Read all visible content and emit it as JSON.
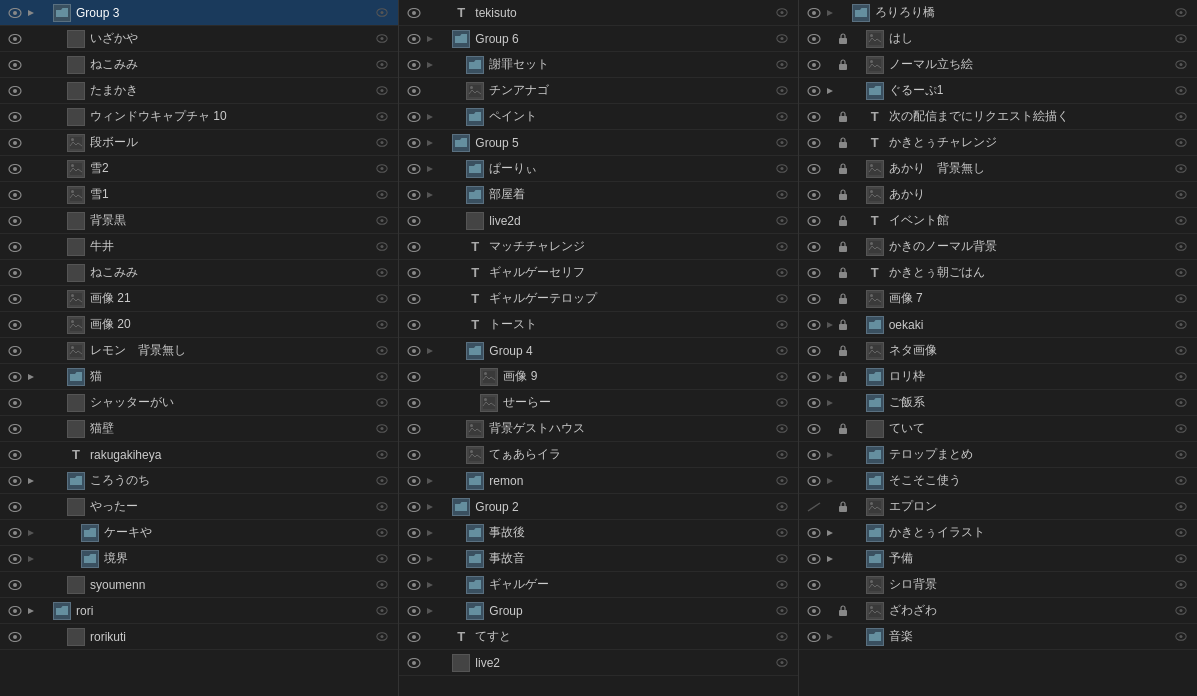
{
  "colors": {
    "bg": "#1e1e1e",
    "selected": "#1a3a5c",
    "text": "#cccccc",
    "muted": "#888888"
  },
  "columns": [
    {
      "id": "col1",
      "items": [
        {
          "name": "Group 3",
          "type": "folder",
          "indent": 0,
          "eye": true,
          "lock": false,
          "expand": true,
          "selected": true
        },
        {
          "name": "いざかや",
          "type": "layer",
          "indent": 1,
          "eye": true,
          "lock": false,
          "expand": false
        },
        {
          "name": "ねこみみ",
          "type": "layer",
          "indent": 1,
          "eye": true,
          "lock": false,
          "expand": false
        },
        {
          "name": "たまかき",
          "type": "layer",
          "indent": 1,
          "eye": true,
          "lock": false,
          "expand": false
        },
        {
          "name": "ウィンドウキャプチャ 10",
          "type": "layer",
          "indent": 1,
          "eye": true,
          "lock": false,
          "expand": false
        },
        {
          "name": "段ボール",
          "type": "image",
          "indent": 1,
          "eye": true,
          "lock": false,
          "expand": false
        },
        {
          "name": "雪2",
          "type": "image",
          "indent": 1,
          "eye": true,
          "lock": false,
          "expand": false
        },
        {
          "name": "雪1",
          "type": "image",
          "indent": 1,
          "eye": true,
          "lock": false,
          "expand": false
        },
        {
          "name": "背景黒",
          "type": "layer",
          "indent": 1,
          "eye": true,
          "lock": false,
          "expand": false
        },
        {
          "name": "牛井",
          "type": "layer",
          "indent": 1,
          "eye": true,
          "lock": false,
          "expand": false
        },
        {
          "name": "ねこみみ",
          "type": "layer",
          "indent": 1,
          "eye": true,
          "lock": false,
          "expand": false
        },
        {
          "name": "画像 21",
          "type": "image",
          "indent": 1,
          "eye": true,
          "lock": false,
          "expand": false
        },
        {
          "name": "画像 20",
          "type": "image",
          "indent": 1,
          "eye": true,
          "lock": false,
          "expand": false
        },
        {
          "name": "レモン　背景無し",
          "type": "image",
          "indent": 1,
          "eye": true,
          "lock": false,
          "expand": false
        },
        {
          "name": "猫",
          "type": "folder",
          "indent": 1,
          "eye": true,
          "lock": false,
          "expand": true
        },
        {
          "name": "シャッターがい",
          "type": "layer",
          "indent": 1,
          "eye": true,
          "lock": false,
          "expand": false
        },
        {
          "name": "猫壁",
          "type": "layer",
          "indent": 1,
          "eye": true,
          "lock": false,
          "expand": false
        },
        {
          "name": "rakugakiheya",
          "type": "text",
          "indent": 1,
          "eye": true,
          "lock": false,
          "expand": false
        },
        {
          "name": "ころうのち",
          "type": "folder",
          "indent": 1,
          "eye": true,
          "lock": false,
          "expand": true
        },
        {
          "name": "やったー",
          "type": "layer",
          "indent": 1,
          "eye": true,
          "lock": false,
          "expand": false
        },
        {
          "name": "ケーキや",
          "type": "folder",
          "indent": 2,
          "eye": true,
          "lock": false,
          "expand": false
        },
        {
          "name": "境界",
          "type": "folder",
          "indent": 2,
          "eye": true,
          "lock": false,
          "expand": false
        },
        {
          "name": "syoumenn",
          "type": "layer",
          "indent": 1,
          "eye": true,
          "lock": false,
          "expand": false
        },
        {
          "name": "rori",
          "type": "folder",
          "indent": 0,
          "eye": true,
          "lock": false,
          "expand": true
        },
        {
          "name": "rorikuti",
          "type": "layer",
          "indent": 1,
          "eye": true,
          "lock": false,
          "expand": false
        }
      ]
    },
    {
      "id": "col2",
      "items": [
        {
          "name": "tekisuto",
          "type": "text",
          "indent": 0,
          "eye": true,
          "lock": false,
          "expand": false
        },
        {
          "name": "Group 6",
          "type": "folder",
          "indent": 0,
          "eye": true,
          "lock": false,
          "expand": false
        },
        {
          "name": "謝罪セット",
          "type": "folder",
          "indent": 1,
          "eye": true,
          "lock": false,
          "expand": false
        },
        {
          "name": "チンアナゴ",
          "type": "image",
          "indent": 1,
          "eye": true,
          "lock": false,
          "expand": false
        },
        {
          "name": "ペイント",
          "type": "folder",
          "indent": 1,
          "eye": true,
          "lock": false,
          "expand": false
        },
        {
          "name": "Group 5",
          "type": "folder",
          "indent": 0,
          "eye": true,
          "lock": false,
          "expand": false
        },
        {
          "name": "ぱーりぃ",
          "type": "folder",
          "indent": 1,
          "eye": true,
          "lock": false,
          "expand": false
        },
        {
          "name": "部屋着",
          "type": "folder",
          "indent": 1,
          "eye": true,
          "lock": false,
          "expand": false
        },
        {
          "name": "live2d",
          "type": "layer",
          "indent": 1,
          "eye": true,
          "lock": false,
          "expand": false
        },
        {
          "name": "マッチチャレンジ",
          "type": "text",
          "indent": 1,
          "eye": true,
          "lock": false,
          "expand": false
        },
        {
          "name": "ギャルゲーセリフ",
          "type": "text",
          "indent": 1,
          "eye": true,
          "lock": false,
          "expand": false
        },
        {
          "name": "ギャルゲーテロップ",
          "type": "text",
          "indent": 1,
          "eye": true,
          "lock": false,
          "expand": false
        },
        {
          "name": "トースト",
          "type": "text",
          "indent": 1,
          "eye": true,
          "lock": false,
          "expand": false
        },
        {
          "name": "Group 4",
          "type": "folder",
          "indent": 1,
          "eye": true,
          "lock": false,
          "expand": false
        },
        {
          "name": "画像 9",
          "type": "image",
          "indent": 2,
          "eye": true,
          "lock": false,
          "expand": false
        },
        {
          "name": "せーらー",
          "type": "image",
          "indent": 2,
          "eye": true,
          "lock": false,
          "expand": false
        },
        {
          "name": "背景ゲストハウス",
          "type": "image",
          "indent": 1,
          "eye": true,
          "lock": false,
          "expand": false
        },
        {
          "name": "てぁあらイラ",
          "type": "image",
          "indent": 1,
          "eye": true,
          "lock": false,
          "expand": false
        },
        {
          "name": "remon",
          "type": "folder",
          "indent": 1,
          "eye": true,
          "lock": false,
          "expand": false
        },
        {
          "name": "Group 2",
          "type": "folder",
          "indent": 0,
          "eye": true,
          "lock": false,
          "expand": false
        },
        {
          "name": "事故後",
          "type": "folder",
          "indent": 1,
          "eye": true,
          "lock": false,
          "expand": false
        },
        {
          "name": "事故音",
          "type": "folder",
          "indent": 1,
          "eye": true,
          "lock": false,
          "expand": false
        },
        {
          "name": "ギャルゲー",
          "type": "folder",
          "indent": 1,
          "eye": true,
          "lock": false,
          "expand": false
        },
        {
          "name": "Group",
          "type": "folder",
          "indent": 1,
          "eye": true,
          "lock": false,
          "expand": false
        },
        {
          "name": "てすと",
          "type": "text",
          "indent": 0,
          "eye": true,
          "lock": false,
          "expand": false
        },
        {
          "name": "live2",
          "type": "layer",
          "indent": 0,
          "eye": true,
          "lock": false,
          "expand": false
        }
      ]
    },
    {
      "id": "col3",
      "items": [
        {
          "name": "ろりろり橋",
          "type": "folder",
          "indent": 0,
          "eye": true,
          "lock": false,
          "expand": false
        },
        {
          "name": "はし",
          "type": "image",
          "indent": 1,
          "eye": true,
          "lock": true,
          "expand": false
        },
        {
          "name": "ノーマル立ち絵",
          "type": "image",
          "indent": 1,
          "eye": true,
          "lock": true,
          "expand": false
        },
        {
          "name": "ぐるーぷ1",
          "type": "folder",
          "indent": 1,
          "eye": true,
          "lock": false,
          "expand": true
        },
        {
          "name": "次の配信までにリクエスト絵描く",
          "type": "text",
          "indent": 1,
          "eye": true,
          "lock": true,
          "expand": false
        },
        {
          "name": "かきとぅチャレンジ",
          "type": "text",
          "indent": 1,
          "eye": true,
          "lock": true,
          "expand": false
        },
        {
          "name": "あかり　背景無し",
          "type": "image",
          "indent": 1,
          "eye": true,
          "lock": true,
          "expand": false
        },
        {
          "name": "あかり",
          "type": "image",
          "indent": 1,
          "eye": true,
          "lock": true,
          "expand": false
        },
        {
          "name": "イベント館",
          "type": "text",
          "indent": 1,
          "eye": true,
          "lock": true,
          "expand": false
        },
        {
          "name": "かきのノーマル背景",
          "type": "image",
          "indent": 1,
          "eye": true,
          "lock": true,
          "expand": false
        },
        {
          "name": "かきとぅ朝ごはん",
          "type": "text",
          "indent": 1,
          "eye": true,
          "lock": true,
          "expand": false
        },
        {
          "name": "画像 7",
          "type": "image",
          "indent": 1,
          "eye": true,
          "lock": true,
          "expand": false
        },
        {
          "name": "oekaki",
          "type": "folder",
          "indent": 1,
          "eye": true,
          "lock": true,
          "expand": false
        },
        {
          "name": "ネタ画像",
          "type": "image",
          "indent": 1,
          "eye": true,
          "lock": true,
          "expand": false
        },
        {
          "name": "ロリ枠",
          "type": "folder",
          "indent": 1,
          "eye": true,
          "lock": true,
          "expand": false
        },
        {
          "name": "ご飯系",
          "type": "folder",
          "indent": 1,
          "eye": true,
          "lock": false,
          "expand": false
        },
        {
          "name": "ていて",
          "type": "layer",
          "indent": 1,
          "eye": true,
          "lock": true,
          "expand": false
        },
        {
          "name": "テロップまとめ",
          "type": "folder",
          "indent": 1,
          "eye": true,
          "lock": false,
          "expand": false
        },
        {
          "name": "そこそこ使う",
          "type": "folder",
          "indent": 1,
          "eye": true,
          "lock": false,
          "expand": false
        },
        {
          "name": "エプロン",
          "type": "image",
          "indent": 1,
          "eye": false,
          "lock": true,
          "expand": false
        },
        {
          "name": "かきとぅイラスト",
          "type": "folder",
          "indent": 1,
          "eye": true,
          "lock": false,
          "expand": true
        },
        {
          "name": "予備",
          "type": "folder",
          "indent": 1,
          "eye": true,
          "lock": false,
          "expand": true
        },
        {
          "name": "シロ背景",
          "type": "image",
          "indent": 1,
          "eye": true,
          "lock": false,
          "expand": false
        },
        {
          "name": "ざわざわ",
          "type": "image",
          "indent": 1,
          "eye": true,
          "lock": true,
          "expand": false
        },
        {
          "name": "音楽",
          "type": "folder",
          "indent": 1,
          "eye": true,
          "lock": false,
          "expand": false
        }
      ]
    }
  ]
}
